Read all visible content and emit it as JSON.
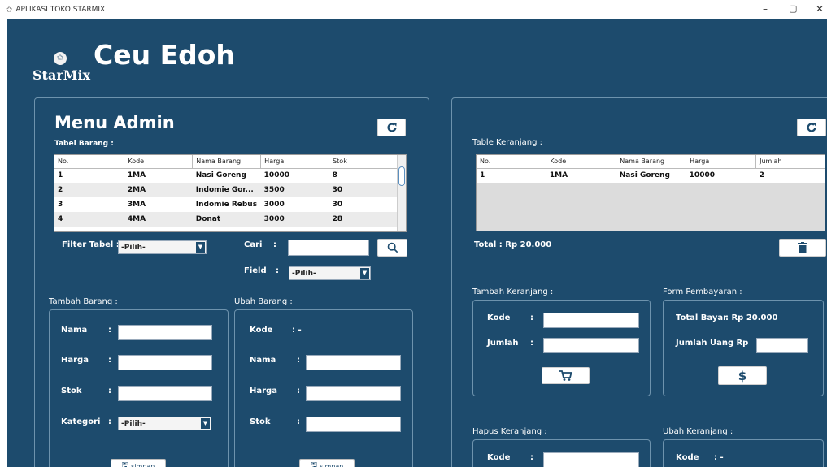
{
  "window": {
    "title": "APLIKASI TOKO STARMIX",
    "icon": "star-icon",
    "controls": [
      "–",
      "▢",
      "✕"
    ]
  },
  "brand": {
    "logo_text": "StarMix",
    "logo_icon": "star-icon",
    "store_name": "Ceu Edoh"
  },
  "admin": {
    "heading": "Menu Admin",
    "table_label": "Tabel Barang :",
    "columns": [
      "No.",
      "Kode",
      "Nama Barang",
      "Harga",
      "Stok"
    ],
    "rows": [
      [
        "1",
        "1MA",
        "Nasi Goreng",
        "10000",
        "8"
      ],
      [
        "2",
        "2MA",
        "Indomie Gor...",
        "3500",
        "30"
      ],
      [
        "3",
        "3MA",
        "Indomie Rebus",
        "3000",
        "30"
      ],
      [
        "4",
        "4MA",
        "Donat",
        "3000",
        "28"
      ]
    ],
    "filter_label": "Filter Tabel :",
    "filter_value": "-Pilih-",
    "cari_label": "Cari",
    "cari_colon": ":",
    "field_label": "Field",
    "field_colon": ":",
    "field_value": "-Pilih-"
  },
  "tambah_barang": {
    "label": "Tambah Barang :",
    "nama": "Nama",
    "harga": "Harga",
    "stok": "Stok",
    "kategori": "Kategori",
    "colon": ":",
    "kategori_value": "-Pilih-",
    "simpan": "simpan"
  },
  "ubah_barang": {
    "label": "Ubah Barang :",
    "kode": "Kode",
    "kode_value": ":  -",
    "nama": "Nama",
    "harga": "Harga",
    "stok": "Stok",
    "colon": ":",
    "simpan": "simpan"
  },
  "keranjang": {
    "table_label": "Table Keranjang :",
    "columns": [
      "No.",
      "Kode",
      "Nama Barang",
      "Harga",
      "Jumlah"
    ],
    "rows": [
      [
        "1",
        "1MA",
        "Nasi Goreng",
        "10000",
        "2"
      ]
    ],
    "total": "Total : Rp  20.000"
  },
  "tambah_keranjang": {
    "label": "Tambah Keranjang :",
    "kode": "Kode",
    "jumlah": "Jumlah",
    "colon": ":"
  },
  "pembayaran": {
    "label": "Form Pembayaran :",
    "total_bayar": "Total Bayar",
    "total_value": ": Rp  20.000",
    "jumlah_uang": "Jumlah Uang",
    "jumlah_colon": ": Rp"
  },
  "hapus_keranjang": {
    "label": "Hapus Keranjang :",
    "kode": "Kode",
    "colon": ":"
  },
  "ubah_keranjang": {
    "label": "Ubah Keranjang :",
    "kode": "Kode",
    "kode_value": ":  -"
  }
}
